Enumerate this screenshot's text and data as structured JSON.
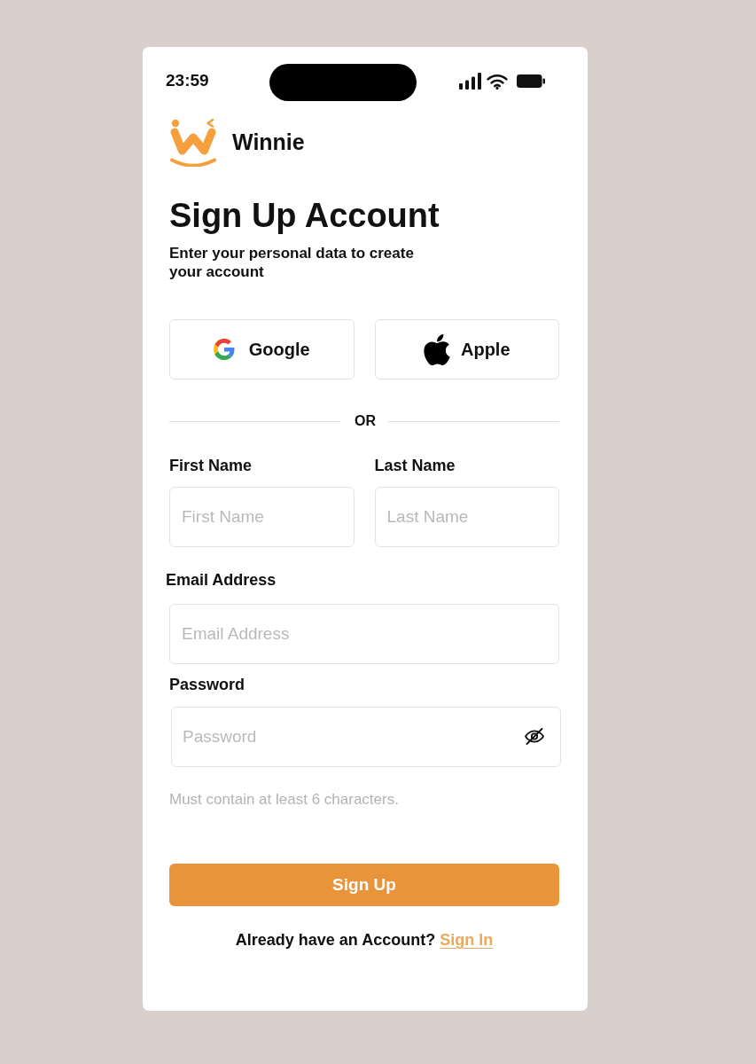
{
  "status_bar": {
    "time": "23:59"
  },
  "brand": {
    "name": "Winnie"
  },
  "heading": {
    "title": "Sign Up Account",
    "subtitle": "Enter your personal data to create your account"
  },
  "social_buttons": [
    {
      "kind": "google",
      "label": "Google"
    },
    {
      "kind": "apple",
      "label": "Apple"
    }
  ],
  "divider": {
    "label": "OR"
  },
  "name_fields": [
    {
      "label": "First Name",
      "placeholder": "First Name"
    },
    {
      "label": "Last Name",
      "placeholder": "Last Name"
    }
  ],
  "email_field": {
    "label": "Email Address",
    "placeholder": "Email Address"
  },
  "password_field": {
    "label": "Password",
    "placeholder": "Password",
    "hint": "Must contain at least 6 characters."
  },
  "submit_button": {
    "label": "Sign Up"
  },
  "footer": {
    "text": "Already have an Account?",
    "link": "Sign In"
  }
}
